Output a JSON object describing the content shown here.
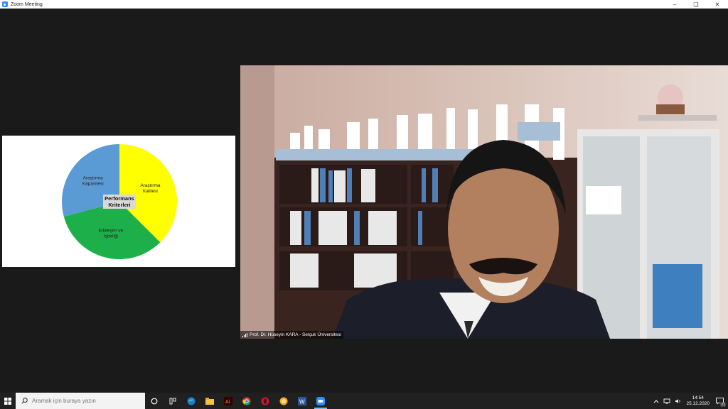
{
  "window": {
    "title": "Zoom Meeting"
  },
  "shared_screen": {
    "chart_data": {
      "type": "pie",
      "center_label": [
        "Performans",
        "Kriterleri"
      ],
      "slices": [
        {
          "label": [
            "Araştırma",
            "Kalitesi"
          ],
          "value": 37.5,
          "color": "#ffff00"
        },
        {
          "label": [
            "Etkileşim ve",
            "İşbirliği"
          ],
          "value": 33.3,
          "color": "#1db04a"
        },
        {
          "label": [
            "Araştırma",
            "Kapasitesi"
          ],
          "value": 29.2,
          "color": "#5b9bd5"
        }
      ]
    }
  },
  "video": {
    "participant_name": "Prof. Dr. Hüseyin KARA - Selçuk Üniversitesi"
  },
  "taskbar": {
    "search_placeholder": "Aramak için buraya yazın",
    "time": "14:54",
    "date": "25.12.2020",
    "notification_count": "22",
    "apps": [
      "task-view",
      "widgets",
      "edge",
      "file-explorer",
      "illustrator",
      "chrome",
      "opera",
      "chrome-canary",
      "word",
      "zoom"
    ]
  }
}
